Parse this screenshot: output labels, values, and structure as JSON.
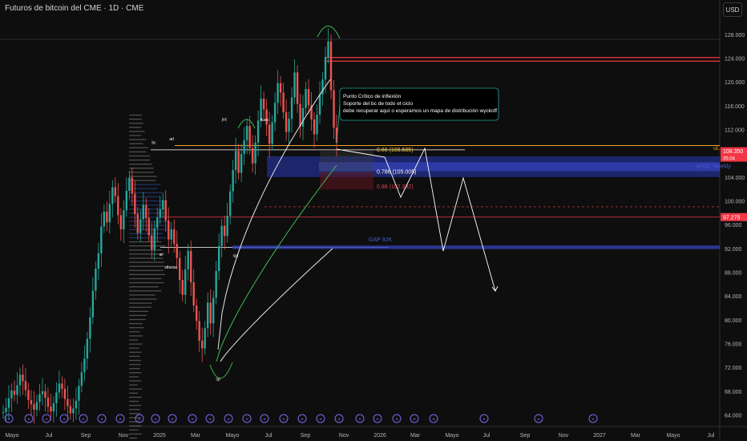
{
  "header": {
    "symbol_title": "Futuros de bitcoin del CME · 1D · CME",
    "currency": "USD"
  },
  "chart_data": {
    "type": "candlestick",
    "ylim": [
      63,
      130
    ],
    "y_ticks": [
      64,
      68,
      72,
      76,
      80,
      84,
      88,
      92,
      96,
      100,
      104,
      108,
      112,
      116,
      120,
      124,
      128
    ],
    "y_tick_labels": [
      "64.000",
      "68.000",
      "72.000",
      "76.000",
      "80.000",
      "84.000",
      "88.000",
      "92.000",
      "96.000",
      "100.000",
      "104.000",
      "108.000",
      "112.000",
      "116.000",
      "120.000",
      "124.000",
      "128.000"
    ],
    "x_labels": [
      "Mayo",
      "Jul",
      "Sep",
      "Nov",
      "2025",
      "Mar",
      "Mayo",
      "Jul",
      "Sep",
      "Nov",
      "2026",
      "Mar",
      "Mayo",
      "Jul",
      "Sep",
      "Nov",
      "2027",
      "Mar",
      "Mayo",
      "Jul"
    ],
    "price_close": [
      64.5,
      65.2,
      66.8,
      68.1,
      67.4,
      69.0,
      70.8,
      69.7,
      68.2,
      66.5,
      65.8,
      64.9,
      66.2,
      67.5,
      68.0,
      66.9,
      65.4,
      64.6,
      66.0,
      67.8,
      69.3,
      68.4,
      66.7,
      65.5,
      64.3,
      65.1,
      66.4,
      68.9,
      71.2,
      73.5,
      76.8,
      80.4,
      84.9,
      88.6,
      91.2,
      95.7,
      98.2,
      96.4,
      99.5,
      102.3,
      100.8,
      97.6,
      95.2,
      98.4,
      101.7,
      103.9,
      101.2,
      97.8,
      94.6,
      96.9,
      99.3,
      97.1,
      94.2,
      91.8,
      95.4,
      97.2,
      98.6,
      100.1,
      96.7,
      93.5,
      95.2,
      92.8,
      90.4,
      86.7,
      84.2,
      88.5,
      91.6,
      86.3,
      82.4,
      79.8,
      76.5,
      75.2,
      78.6,
      82.9,
      79.4,
      83.7,
      88.2,
      92.4,
      95.8,
      94.1,
      97.5,
      101.6,
      105.2,
      108.4,
      104.7,
      107.9,
      110.2,
      112.6,
      108.9,
      106.3,
      109.8,
      113.5,
      117.2,
      115.4,
      112.8,
      109.6,
      113.2,
      116.5,
      119.8,
      118.2,
      114.9,
      111.6,
      113.8,
      117.4,
      121.6,
      116.3,
      112.5,
      115.6,
      118.8,
      116.1,
      113.7,
      111.2,
      114.5,
      117.9,
      120.4,
      124.2,
      126.8,
      118.6,
      112.3,
      109.8
    ],
    "levels": [
      {
        "label": "0.66 (108.585)",
        "value": 108.585,
        "color": "#f0c030"
      },
      {
        "label": "0.786 (105.005)",
        "value": 105.005,
        "color": "#ffffff"
      },
      {
        "label": "0.88 (102.332)",
        "value": 102.332,
        "color": "#e04050"
      },
      {
        "label": "nPOC Weekly",
        "value": 105.8,
        "color": "#4a5adc"
      },
      {
        "label": "GAP 92K",
        "value": 92.2,
        "color": "#4a5adc"
      },
      {
        "label": "uL",
        "value": 109.0,
        "color": "#ff9800"
      }
    ],
    "price_badges": [
      {
        "value": 108.35,
        "label": "108.350",
        "sub": "35:04",
        "color": "#f23645"
      },
      {
        "value": 97.275,
        "label": "97.275",
        "color": "#f23645"
      }
    ],
    "annotation": {
      "lines": [
        "Punto Crítico de inflexión",
        "Soporte del bc de todo el ciclo",
        "debe recuperar aquí o esperamos un mapa de distribución wyckoff"
      ]
    },
    "wyckoff_labels": [
      {
        "text": "bc",
        "x": 192,
        "value": 109.6
      },
      {
        "text": "ad",
        "x": 214,
        "value": 110.2
      },
      {
        "text": "ar",
        "x": 201,
        "value": 90.8
      },
      {
        "text": "stbsow",
        "x": 213,
        "value": 88.6
      },
      {
        "text": "sp",
        "x": 272,
        "value": 69.8
      },
      {
        "text": "spt",
        "x": 294,
        "value": 90.6
      },
      {
        "text": "joc",
        "x": 280,
        "value": 113.5
      },
      {
        "text": "buec",
        "x": 330,
        "value": 113.4
      }
    ],
    "projection": [
      [
        420,
        186
      ],
      [
        480,
        196
      ],
      [
        500,
        246
      ],
      [
        530,
        185
      ],
      [
        553,
        313
      ],
      [
        578,
        222
      ],
      [
        618,
        363
      ]
    ],
    "projection_value_points": [
      {
        "date_index": 0,
        "value": 108.4
      },
      {
        "date_index": 1,
        "value": 106.8
      },
      {
        "date_index": 2,
        "value": 101.4
      },
      {
        "date_index": 3,
        "value": 107.6
      },
      {
        "date_index": 4,
        "value": 92.3
      },
      {
        "date_index": 5,
        "value": 104.1
      },
      {
        "date_index": 6,
        "value": 85.4
      }
    ]
  }
}
